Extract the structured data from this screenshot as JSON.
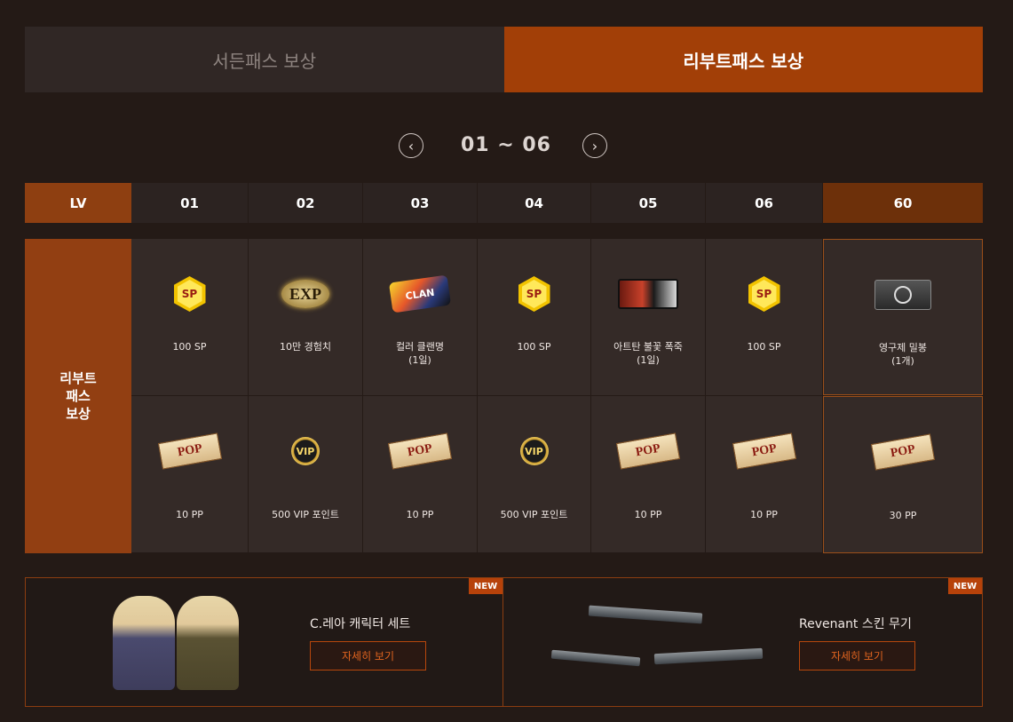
{
  "tabs": [
    {
      "label": "서든패스 보상",
      "active": false
    },
    {
      "label": "리부트패스 보상",
      "active": true
    }
  ],
  "pager": {
    "range": "01 ~ 06",
    "prev_icon": "chevron-left-icon",
    "next_icon": "chevron-right-icon"
  },
  "table": {
    "lv_label": "LV",
    "levels": [
      "01",
      "02",
      "03",
      "04",
      "05",
      "06"
    ],
    "final_level": "60",
    "row_label": "리부트\n패스\n보상",
    "top_rewards": [
      {
        "icon": "sp-coin-icon",
        "label": "100 SP"
      },
      {
        "icon": "exp-badge-icon",
        "label": "10만 경험치"
      },
      {
        "icon": "color-clan-icon",
        "label": "컬러 클랜명\n(1일)"
      },
      {
        "icon": "sp-coin-icon",
        "label": "100 SP"
      },
      {
        "icon": "firework-icon",
        "label": "아트탄 불꽃 폭죽\n(1일)"
      },
      {
        "icon": "sp-coin-icon",
        "label": "100 SP"
      }
    ],
    "bottom_rewards": [
      {
        "icon": "pop-ticket-icon",
        "label": "10 PP"
      },
      {
        "icon": "vip-coin-icon",
        "label": "500 VIP 포인트"
      },
      {
        "icon": "pop-ticket-icon",
        "label": "10 PP"
      },
      {
        "icon": "vip-coin-icon",
        "label": "500 VIP 포인트"
      },
      {
        "icon": "pop-ticket-icon",
        "label": "10 PP"
      },
      {
        "icon": "pop-ticket-icon",
        "label": "10 PP"
      }
    ],
    "final_top": {
      "icon": "lock-box-icon",
      "label": "영구제 밀봉\n(1개)"
    },
    "final_bottom": {
      "icon": "pop-ticket-icon",
      "label": "30 PP"
    }
  },
  "promos": [
    {
      "badge": "NEW",
      "title": "C.레아 캐릭터 세트",
      "button": "자세히 보기"
    },
    {
      "badge": "NEW",
      "title": "Revenant 스킨 무기",
      "button": "자세히 보기"
    }
  ],
  "icon_text": {
    "sp": "SP",
    "exp": "EXP",
    "clan": "CLAN",
    "pop": "POP",
    "vip": "VIP"
  },
  "colors": {
    "accent": "#a23f07",
    "background": "#241a16",
    "button_text": "#e0641f"
  }
}
